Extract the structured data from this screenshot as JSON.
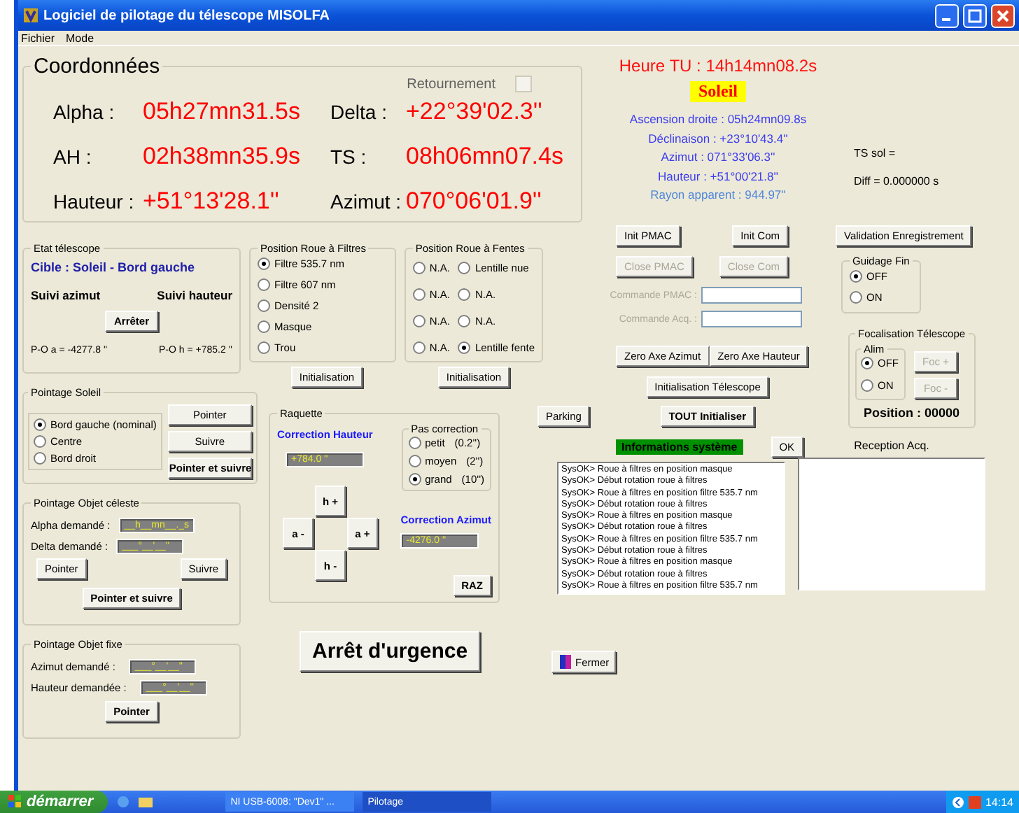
{
  "window": {
    "title": "Logiciel de pilotage du télescope MISOLFA"
  },
  "menu": [
    "Fichier",
    "Mode"
  ],
  "coordinates": {
    "title": "Coordonnées",
    "reversal": {
      "label": "Retournement",
      "checked": false
    },
    "values": [
      {
        "label": "Alpha :",
        "value": "05h27mn31.5s"
      },
      {
        "label": "Delta :",
        "value": "+22°39'02.3''"
      },
      {
        "label": "AH :",
        "value": "02h38mn35.9s"
      },
      {
        "label": "TS :",
        "value": "08h06mn07.4s"
      },
      {
        "label": "Hauteur :",
        "value": "+51°13'28.1''"
      },
      {
        "label": "Azimut :",
        "value": "070°06'01.9''"
      }
    ]
  },
  "sun_info": {
    "time": "Heure TU : 14h14mn08.2s",
    "target": "Soleil",
    "lines": [
      {
        "text": "Ascension droite : 05h24mn09.8s",
        "color": "#3c3cf0"
      },
      {
        "text": "Déclinaison : +23°10'43.4''",
        "color": "#3c3cf0"
      },
      {
        "text": "Azimut : 071°33'06.3''",
        "color": "#3c3cf0"
      },
      {
        "text": "Hauteur : +51°00'21.8''",
        "color": "#3c3cf0"
      },
      {
        "text": "Rayon apparent : 944.97''",
        "color": "#4f86d9"
      }
    ],
    "ts_sol": "TS sol =",
    "diff": "Diff = 0.000000 s"
  },
  "telescope_state": {
    "title": "Etat télescope",
    "target": "Cible : Soleil - Bord gauche",
    "tracking": [
      "Suivi azimut",
      "Suivi hauteur"
    ],
    "stop_button": "Arrêter",
    "offsets": [
      "P-O a = -4277.8 ''",
      "P-O h = +785.2 ''"
    ]
  },
  "filter_wheel": {
    "title": "Position Roue à Filtres",
    "options": [
      {
        "label": "Filtre 535.7 nm",
        "selected": true
      },
      {
        "label": "Filtre 607 nm",
        "selected": false
      },
      {
        "label": "Densité 2",
        "selected": false
      },
      {
        "label": "Masque",
        "selected": false
      },
      {
        "label": "Trou",
        "selected": false
      }
    ],
    "init_button": "Initialisation"
  },
  "slit_wheel": {
    "title": "Position Roue à Fentes",
    "options": [
      {
        "label": "N.A.",
        "selected": false
      },
      {
        "label": "Lentille nue",
        "selected": false
      },
      {
        "label": "N.A.",
        "selected": false
      },
      {
        "label": "N.A.",
        "selected": false
      },
      {
        "label": "N.A.",
        "selected": false
      },
      {
        "label": "N.A.",
        "selected": false
      },
      {
        "label": "N.A.",
        "selected": false
      },
      {
        "label": "Lentille fente",
        "selected": true
      }
    ],
    "init_button": "Initialisation"
  },
  "sun_pointing": {
    "title": "Pointage Soleil",
    "options": [
      {
        "label": "Bord gauche (nominal)",
        "selected": true
      },
      {
        "label": "Centre",
        "selected": false
      },
      {
        "label": "Bord droit",
        "selected": false
      }
    ],
    "buttons": [
      "Pointer",
      "Suivre",
      "Pointer et suivre"
    ]
  },
  "celestial_pointing": {
    "title": "Pointage Objet céleste",
    "fields": [
      {
        "label": "Alpha demandé :",
        "value": "__h__mn__._s"
      },
      {
        "label": "Delta demandé :",
        "value": "___°__'__''"
      }
    ],
    "buttons": [
      "Pointer",
      "Suivre",
      "Pointer et suivre"
    ]
  },
  "fixed_pointing": {
    "title": "Pointage Objet fixe",
    "fields": [
      {
        "label": "Azimut demandé :",
        "value": "___°__'__''"
      },
      {
        "label": "Hauteur demandée :",
        "value": "___°__'__''"
      }
    ],
    "button": "Pointer"
  },
  "paddle": {
    "title": "Raquette",
    "height_label": "Correction Hauteur",
    "height_value": "+784.0 ''",
    "step": {
      "title": "Pas correction",
      "options": [
        {
          "label": "petit",
          "value": "(0.2'')",
          "selected": false
        },
        {
          "label": "moyen",
          "value": "(2'')",
          "selected": false
        },
        {
          "label": "grand",
          "value": "(10'')",
          "selected": true
        }
      ]
    },
    "keys": {
      "up": "h +",
      "left": "a -",
      "right": "a +",
      "down": "h -"
    },
    "azimuth_label": "Correction Azimut",
    "azimuth_value": "-4276.0 ''",
    "reset_button": "RAZ"
  },
  "emergency_button": "Arrêt d'urgence",
  "controls": {
    "init": [
      {
        "label": "Init PMAC",
        "disabled": false
      },
      {
        "label": "Init Com",
        "disabled": false
      }
    ],
    "close": [
      {
        "label": "Close PMAC",
        "disabled": true
      },
      {
        "label": "Close Com",
        "disabled": true
      }
    ],
    "commands": [
      {
        "label": "Commande PMAC :",
        "disabled": true
      },
      {
        "label": "Commande Acq. :",
        "disabled": true
      }
    ],
    "zero": [
      "Zero Axe Azimut",
      "Zero Axe Hauteur"
    ],
    "init_telescope": "Initialisation Télescope",
    "parking": "Parking",
    "init_all": "TOUT Initialiser",
    "close_button": "Fermer"
  },
  "save_button": "Validation Enregistrement",
  "fine_guiding": {
    "title": "Guidage Fin",
    "options": [
      {
        "label": "OFF",
        "selected": true
      },
      {
        "label": "ON",
        "selected": false
      }
    ]
  },
  "focus": {
    "title": "Focalisation Télescope",
    "power": {
      "title": "Alim",
      "options": [
        {
          "label": "OFF",
          "selected": true
        },
        {
          "label": "ON",
          "selected": false
        }
      ]
    },
    "buttons": [
      {
        "label": "Foc +",
        "disabled": true
      },
      {
        "label": "Foc -",
        "disabled": true
      }
    ],
    "position": "Position : 00000"
  },
  "system_info": {
    "title": "Informations système",
    "ok_button": "OK",
    "lines": [
      "SysOK> Roue à filtres en position masque",
      "SysOK> Début rotation roue à filtres",
      "SysOK> Roue à filtres en position filtre 535.7 nm",
      "SysOK> Début rotation roue à filtres",
      "SysOK> Roue à filtres en position masque",
      "SysOK> Début rotation roue à filtres",
      "SysOK> Roue à filtres en position filtre 535.7 nm",
      "SysOK> Début rotation roue à filtres",
      "SysOK> Roue à filtres en position masque",
      "SysOK> Début rotation roue à filtres",
      "SysOK> Roue à filtres en position filtre 535.7 nm"
    ]
  },
  "reception": {
    "title": "Reception Acq."
  },
  "taskbar": {
    "start": "démarrer",
    "tasks": [
      {
        "label": "NI USB-6008: \"Dev1\" ...",
        "selected": false
      },
      {
        "label": "Pilotage",
        "selected": true
      }
    ],
    "clock": "14:14"
  }
}
